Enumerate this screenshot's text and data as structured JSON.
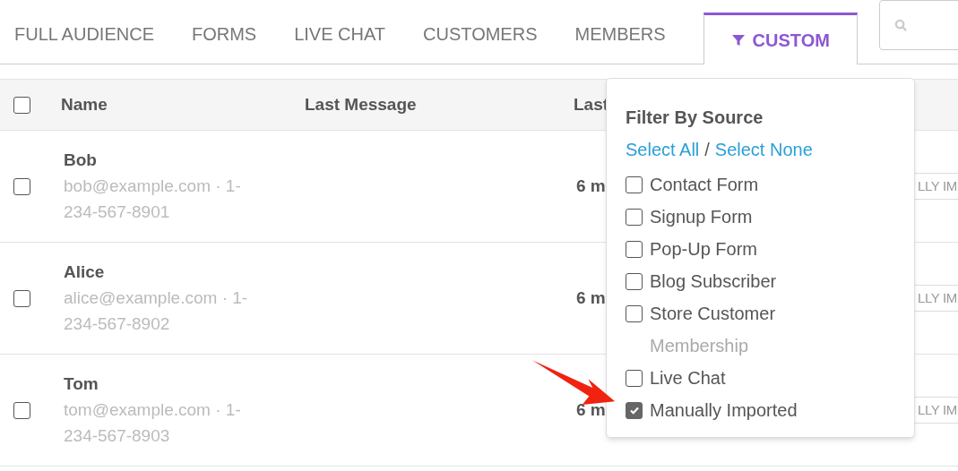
{
  "tabs": [
    {
      "label": "FULL AUDIENCE",
      "selected": false
    },
    {
      "label": "FORMS",
      "selected": false
    },
    {
      "label": "LIVE CHAT",
      "selected": false
    },
    {
      "label": "CUSTOMERS",
      "selected": false
    },
    {
      "label": "MEMBERS",
      "selected": false
    },
    {
      "label": "CUSTOM",
      "selected": true
    }
  ],
  "table": {
    "select_all": {
      "checked": false
    },
    "columns": [
      "Name",
      "Last Message",
      "Last"
    ],
    "rows": [
      {
        "checked": false,
        "name": "Bob",
        "contact": "bob@example.com · 1-234-567-8901",
        "column_3": "6 m",
        "tag": "LLY IM"
      },
      {
        "checked": false,
        "name": "Alice",
        "contact": "alice@example.com · 1-234-567-8902",
        "column_3": "6 m",
        "tag": "LLY IM"
      },
      {
        "checked": false,
        "name": "Tom",
        "contact": "tom@example.com · 1-234-567-8903",
        "column_3": "6 m",
        "tag": "LLY IM"
      }
    ]
  },
  "filter_popover": {
    "title": "Filter By Source",
    "select_all": "Select All",
    "separator": "/",
    "select_none": "Select None",
    "options": [
      {
        "label": "Contact Form",
        "disabled": false,
        "checked": false
      },
      {
        "label": "Signup Form",
        "disabled": false,
        "checked": false
      },
      {
        "label": "Pop-Up Form",
        "disabled": false,
        "checked": false
      },
      {
        "label": "Blog Subscriber",
        "disabled": false,
        "checked": false
      },
      {
        "label": "Store Customer",
        "disabled": false,
        "checked": false
      },
      {
        "label": "Membership",
        "disabled": true
      },
      {
        "label": "Live Chat",
        "disabled": false,
        "checked": false
      },
      {
        "label": "Manually Imported",
        "disabled": false,
        "checked": true
      }
    ]
  }
}
